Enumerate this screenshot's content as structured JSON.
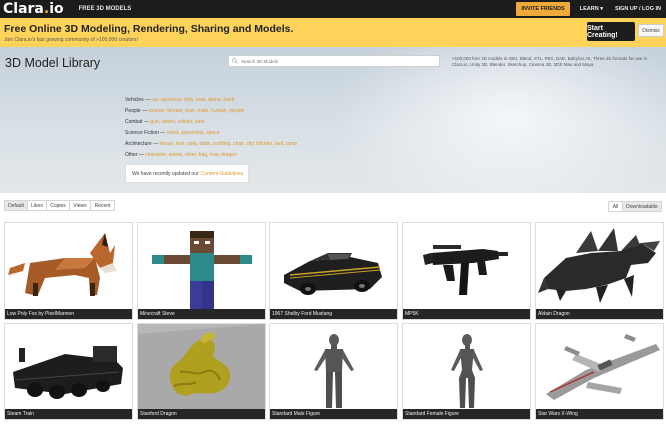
{
  "nav": {
    "logo_main": "Clara",
    "logo_dot": ".",
    "logo_suffix": "io",
    "free_models": "FREE 3D MODELS",
    "invite": "INVITE FRIENDS",
    "learn": "LEARN ▾",
    "signup": "SIGN UP / LOG IN"
  },
  "banner": {
    "title": "Free Online 3D Modeling, Rendering, Sharing and Models.",
    "subtitle": "Join Clara.io's fast growing community of >100,000 creators!",
    "start_button": "Start Creating!",
    "dismiss_button": "Dismiss"
  },
  "hero": {
    "title": "3D Model Library",
    "search_placeholder": "Search 3D Models",
    "description": ">100,000 free 3D models in OBJ, Blend, STL, FBX, DAE, Babylon.JS, Three.JS formats for use in Clara.io, Unity 3D, Blender, Sketchup, Cinema 4D, 3DS Max and Maya.",
    "categories": [
      {
        "name": "Vehicles",
        "items": "car, sportscar, ship, boat, plane, truck"
      },
      {
        "name": "People",
        "items": "woman, female, man, male, human, people"
      },
      {
        "name": "Combat",
        "items": "gun, sword, soldier, tank"
      },
      {
        "name": "Science Fiction",
        "items": "robot, spaceship, space"
      },
      {
        "name": "Architecture",
        "items": "house, tree, sofa, table, building, chair, city, kitchen, bed, lamp"
      },
      {
        "name": "Other",
        "items": "character, anime, shoe, bag, cow, dragon"
      }
    ],
    "separator": " — ",
    "update_text": "We have recently updated our",
    "update_link": "Content Guidelines."
  },
  "sort_tabs": [
    "Default",
    "Likes",
    "Copies",
    "Views",
    "Recent"
  ],
  "filter_tabs": [
    "All",
    "Downloadable"
  ],
  "models": [
    {
      "title": "Low Poly Fox by PixelMannen",
      "bg": "#ffffff"
    },
    {
      "title": "Minecraft Steve",
      "bg": "#ffffff"
    },
    {
      "title": "1967 Shelby Ford Mustang",
      "bg": "#ffffff"
    },
    {
      "title": "MP5K",
      "bg": "#ffffff"
    },
    {
      "title": "Aldain Dragon",
      "bg": "#ffffff"
    },
    {
      "title": "Steam Train",
      "bg": "#ffffff"
    },
    {
      "title": "Stanford Dragon",
      "bg": "#b7b7b7"
    },
    {
      "title": "Standard Male Figure",
      "bg": "#ffffff"
    },
    {
      "title": "Standard Female Figure",
      "bg": "#ffffff"
    },
    {
      "title": "Star Wars X-Wing",
      "bg": "#ffffff"
    }
  ],
  "colors": {
    "accent": "#f0a93b",
    "banner": "#fdd35a",
    "nav_bg": "#1c1c1c"
  }
}
